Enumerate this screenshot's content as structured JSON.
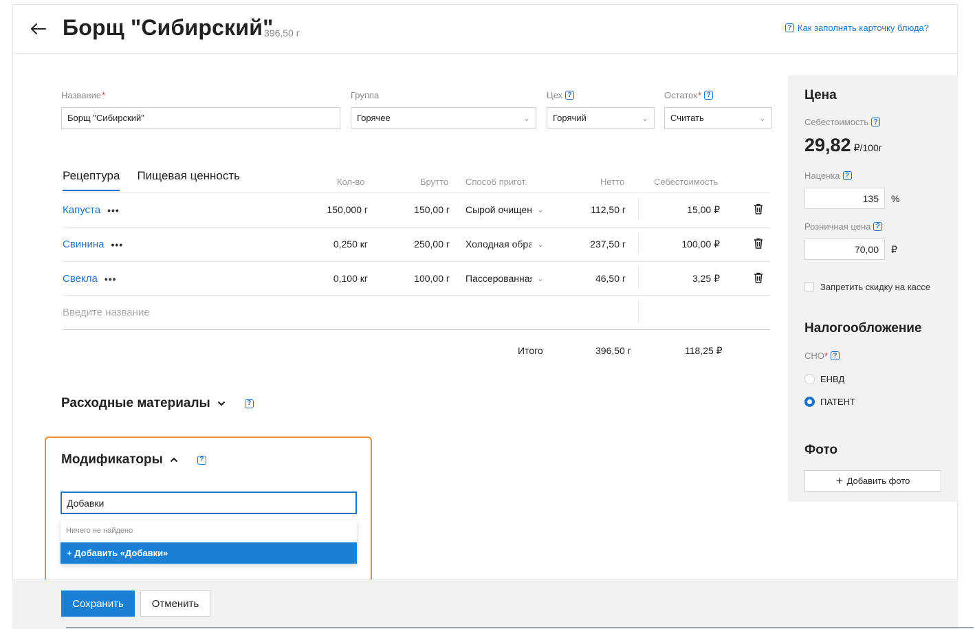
{
  "header": {
    "title": "Борщ \"Сибирский\"",
    "weight": "396,50 г",
    "help_link": "Как заполнять карточку блюда?"
  },
  "fields": {
    "name_label": "Название",
    "name_value": "Борщ \"Сибирский\"",
    "group_label": "Группа",
    "group_value": "Горячее",
    "shop_label": "Цех",
    "shop_value": "Горячий",
    "stock_label": "Остаток",
    "stock_value": "Считать"
  },
  "tabs": [
    "Рецептура",
    "Пищевая ценность"
  ],
  "table": {
    "headers": {
      "qty": "Кол-во",
      "gross": "Брутто",
      "method": "Способ пригот.",
      "net": "Нетто",
      "cost": "Себестоимость"
    },
    "rows": [
      {
        "name": "Капуста",
        "qty": "150,000 г",
        "gross": "150,00 г",
        "method": "Сырой очищен",
        "net": "112,50 г",
        "cost": "15,00 ₽"
      },
      {
        "name": "Свинина",
        "qty": "0,250 кг",
        "gross": "250,00 г",
        "method": "Холодная обра",
        "net": "237,50 г",
        "cost": "100,00 ₽"
      },
      {
        "name": "Свекла",
        "qty": "0,100 кг",
        "gross": "100,00 г",
        "method": "Пассерованная",
        "net": "46,50 г",
        "cost": "3,25 ₽"
      }
    ],
    "new_placeholder": "Введите название",
    "total_label": "Итого",
    "total_net": "396,50 г",
    "total_cost": "118,25 ₽"
  },
  "consumables": {
    "title": "Расходные материалы"
  },
  "modifiers": {
    "title": "Модификаторы",
    "input_value": "Добавки",
    "not_found": "Ничего не найдено",
    "add_option": "+ Добавить «Добавки»"
  },
  "actions": {
    "save": "Сохранить",
    "cancel": "Отменить"
  },
  "price": {
    "title": "Цена",
    "cost_label": "Себестоимость",
    "cost_value": "29,82",
    "cost_unit": "₽/100г",
    "markup_label": "Наценка",
    "markup_value": "135",
    "markup_unit": "%",
    "retail_label": "Розничная цена",
    "retail_value": "70,00",
    "retail_unit": "₽",
    "no_discount_label": "Запретить скидку на кассе",
    "no_discount_checked": false
  },
  "tax": {
    "title": "Налогообложение",
    "sno_label": "СНО",
    "options": [
      "ЕНВД",
      "ПАТЕНТ"
    ],
    "selected": "ПАТЕНТ"
  },
  "photo": {
    "title": "Фото",
    "add_label": "Добавить фото"
  },
  "colors": {
    "accent": "#1b73c9",
    "button": "#1b80d3",
    "highlight": "#f08c2d",
    "required": "#e53935"
  }
}
